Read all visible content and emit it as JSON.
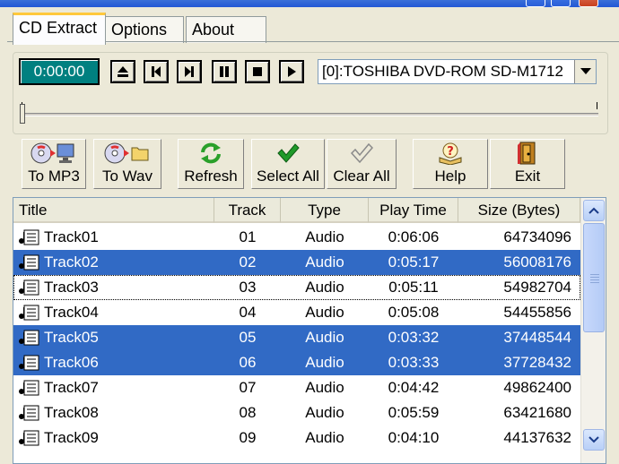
{
  "window": {
    "accent": "#2257d5"
  },
  "tabs": [
    {
      "label": "CD Extract",
      "active": true
    },
    {
      "label": "Options",
      "active": false
    },
    {
      "label": "About",
      "active": false
    }
  ],
  "player": {
    "time": "0:00:00",
    "drive": "[0]:TOSHIBA DVD-ROM SD-M1712",
    "buttons": [
      "eject-icon",
      "previous-icon",
      "next-icon",
      "pause-icon",
      "stop-icon",
      "play-icon"
    ],
    "position_fraction": 0.0
  },
  "toolbar": {
    "to_mp3": "To MP3",
    "to_wav": "To Wav",
    "refresh": "Refresh",
    "select_all": "Select All",
    "clear_all": "Clear All",
    "help": "Help",
    "exit": "Exit"
  },
  "list": {
    "columns": [
      "Title",
      "Track",
      "Type",
      "Play Time",
      "Size (Bytes)"
    ],
    "selection_color": "#316ac5",
    "rows": [
      {
        "title": "Track01",
        "track": "01",
        "type": "Audio",
        "time": "0:06:06",
        "size": "64734096",
        "selected": false
      },
      {
        "title": "Track02",
        "track": "02",
        "type": "Audio",
        "time": "0:05:17",
        "size": "56008176",
        "selected": true
      },
      {
        "title": "Track03",
        "track": "03",
        "type": "Audio",
        "time": "0:05:11",
        "size": "54982704",
        "selected": false,
        "focused": true
      },
      {
        "title": "Track04",
        "track": "04",
        "type": "Audio",
        "time": "0:05:08",
        "size": "54455856",
        "selected": false
      },
      {
        "title": "Track05",
        "track": "05",
        "type": "Audio",
        "time": "0:03:32",
        "size": "37448544",
        "selected": true
      },
      {
        "title": "Track06",
        "track": "06",
        "type": "Audio",
        "time": "0:03:33",
        "size": "37728432",
        "selected": true
      },
      {
        "title": "Track07",
        "track": "07",
        "type": "Audio",
        "time": "0:04:42",
        "size": "49862400",
        "selected": false
      },
      {
        "title": "Track08",
        "track": "08",
        "type": "Audio",
        "time": "0:05:59",
        "size": "63421680",
        "selected": false
      },
      {
        "title": "Track09",
        "track": "09",
        "type": "Audio",
        "time": "0:04:10",
        "size": "44137632",
        "selected": false
      }
    ]
  }
}
